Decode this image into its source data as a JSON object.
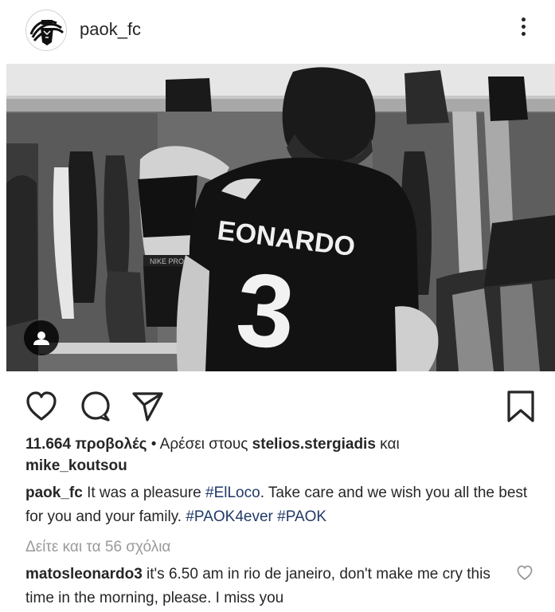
{
  "account": {
    "username": "paok_fc"
  },
  "icons": {
    "avatar": "paok-logo-avatar",
    "more": "more-vertical-icon",
    "like": "heart-icon",
    "comment": "comment-icon",
    "share": "send-icon",
    "save": "bookmark-icon",
    "user_tag": "user-tag-icon",
    "comment_like": "heart-small-icon"
  },
  "photo": {
    "jersey_name": "EONARDO",
    "jersey_number": "3",
    "shorts_text": "NIKE PRO"
  },
  "engagement": {
    "views": "11.664 προβολές",
    "separator": " • ",
    "liked_by_prefix": "Αρέσει στους ",
    "liked_by_user1": "stelios.stergiadis",
    "liked_by_and": " και",
    "liked_by_user2": "mike_koutsou"
  },
  "caption": {
    "author": "paok_fc",
    "text_1": " It was a pleasure ",
    "hashtag_1": "#ElLoco",
    "text_2": ". Take care and we wish you all the best for you and your family. ",
    "hashtag_2": "#PAOK4ever",
    "hashtag_3": "#PAOK"
  },
  "view_comments_label": "Δείτε και τα 56 σχόλια",
  "top_comment": {
    "author": "matosleonardo3",
    "text": " it's 6.50 am in rio de janeiro, don't make me cry this time in the morning, please.  I miss you"
  },
  "colors": {
    "text": "#262626",
    "hashtag": "#203a67",
    "muted": "#9a9a9a",
    "photo_bg": "#3a3a3a"
  }
}
